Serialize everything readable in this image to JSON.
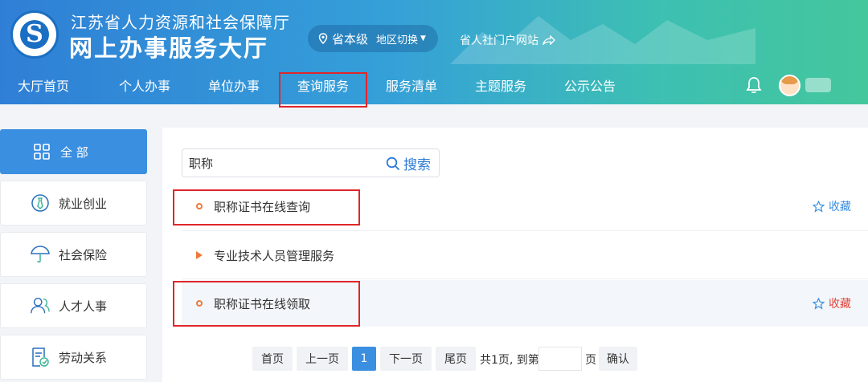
{
  "header": {
    "subtitle": "江苏省人力资源和社会保障厅",
    "title": "网上办事服务大厅",
    "logo_glyph": "S",
    "region_level": "省本级",
    "region_switch": "地区切换",
    "portal_link": "省人社门户网站"
  },
  "nav": {
    "items": [
      "大厅首页",
      "个人办事",
      "单位办事",
      "查询服务",
      "服务清单",
      "主题服务",
      "公示公告"
    ],
    "icons": [
      "bell-icon",
      "avatar"
    ]
  },
  "sidebar": {
    "items": [
      {
        "label": "全 部",
        "icon": "grid-icon"
      },
      {
        "label": "就业创业",
        "icon": "tie-icon"
      },
      {
        "label": "社会保险",
        "icon": "umbrella-icon"
      },
      {
        "label": "人才人事",
        "icon": "people-icon"
      },
      {
        "label": "劳动关系",
        "icon": "document-icon"
      }
    ]
  },
  "search": {
    "value": "职称",
    "button_label": "搜索"
  },
  "results": [
    {
      "title": "职称证书在线查询",
      "favorite_label": "收藏"
    },
    {
      "title": "专业技术人员管理服务"
    },
    {
      "title": "职称证书在线领取",
      "favorite_label": "收藏"
    }
  ],
  "pagination": {
    "first": "首页",
    "prev": "上一页",
    "current": "1",
    "next": "下一页",
    "last": "尾页",
    "summary": "共1页, 到第",
    "page_unit": "页",
    "confirm": "确认"
  },
  "colors": {
    "accent": "#3b8fe0",
    "bullet": "#ee7a3a",
    "highlight": "#e0262b"
  }
}
